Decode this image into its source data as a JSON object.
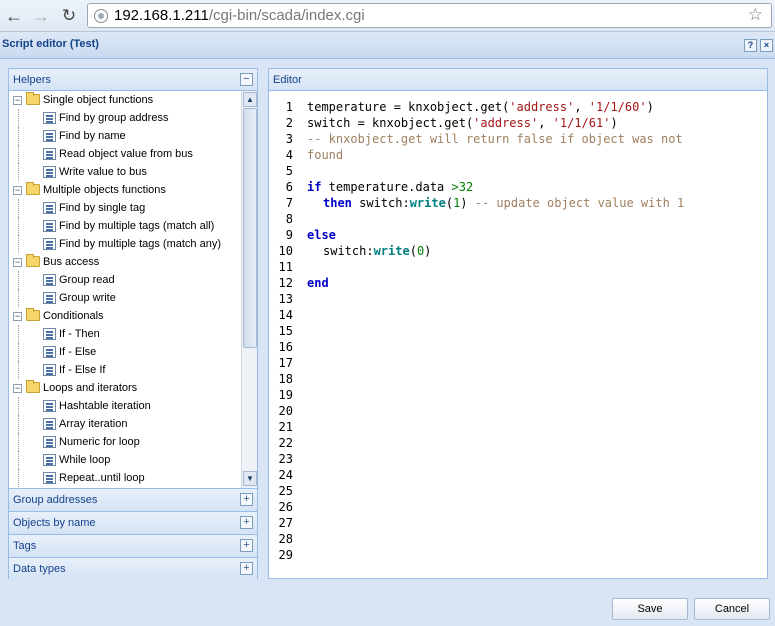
{
  "browser": {
    "url_host": "192.168.1.211",
    "url_path": "/cgi-bin/scada/index.cgi"
  },
  "window": {
    "title": "Script editor (Test)",
    "help_label": "?",
    "close_label": "×"
  },
  "helpers": {
    "title": "Helpers",
    "collapse_label": "−",
    "tree": [
      {
        "type": "folder",
        "label": "Single object functions"
      },
      {
        "type": "leaf",
        "label": "Find by group address"
      },
      {
        "type": "leaf",
        "label": "Find by name"
      },
      {
        "type": "leaf",
        "label": "Read object value from bus"
      },
      {
        "type": "leaf",
        "label": "Write value to bus"
      },
      {
        "type": "folder",
        "label": "Multiple objects functions"
      },
      {
        "type": "leaf",
        "label": "Find by single tag"
      },
      {
        "type": "leaf",
        "label": "Find by multiple tags (match all)"
      },
      {
        "type": "leaf",
        "label": "Find by multiple tags (match any)"
      },
      {
        "type": "folder",
        "label": "Bus access"
      },
      {
        "type": "leaf",
        "label": "Group read"
      },
      {
        "type": "leaf",
        "label": "Group write"
      },
      {
        "type": "folder",
        "label": "Conditionals"
      },
      {
        "type": "leaf",
        "label": "If - Then"
      },
      {
        "type": "leaf",
        "label": "If - Else"
      },
      {
        "type": "leaf",
        "label": "If - Else If"
      },
      {
        "type": "folder",
        "label": "Loops and iterators"
      },
      {
        "type": "leaf",
        "label": "Hashtable iteration"
      },
      {
        "type": "leaf",
        "label": "Array iteration"
      },
      {
        "type": "leaf",
        "label": "Numeric for loop"
      },
      {
        "type": "leaf",
        "label": "While loop"
      },
      {
        "type": "leaf",
        "label": "Repeat..until loop"
      }
    ]
  },
  "accordion": [
    {
      "label": "Group addresses",
      "expand_label": "+"
    },
    {
      "label": "Objects by name",
      "expand_label": "+"
    },
    {
      "label": "Tags",
      "expand_label": "+"
    },
    {
      "label": "Data types",
      "expand_label": "+"
    }
  ],
  "editor": {
    "title": "Editor",
    "line_numbers": [
      "1",
      "2",
      "3",
      "4",
      "5",
      "6",
      "7",
      "8",
      "9",
      "10",
      "11",
      "12",
      "13",
      "14",
      "15",
      "16",
      "17",
      "18",
      "19",
      "20",
      "21",
      "22",
      "23",
      "24",
      "25",
      "26",
      "27",
      "28",
      "29"
    ],
    "code": {
      "l1_a": "temperature = knxobject.get(",
      "l1_b": "'address'",
      "l1_c": ", ",
      "l1_d": "'1/1/60'",
      "l1_e": ")",
      "l2_a": "switch = knxobject.get(",
      "l2_b": "'address'",
      "l2_c": ", ",
      "l2_d": "'1/1/61'",
      "l2_e": ")",
      "l3": "-- knxobject.get will return false if object was not",
      "l3_wrap": "found",
      "l5_kw": "if",
      "l5_a": " temperature.data ",
      "l5_num": ">32",
      "l6_kw": "then",
      "l6_a": " switch:",
      "l6_fn": "write",
      "l6_b": "(",
      "l6_num": "1",
      "l6_c": ") ",
      "l6_cmt": "-- update object value with 1",
      "l8_kw": "else",
      "l9_a": "switch:",
      "l9_fn": "write",
      "l9_b": "(",
      "l9_num": "0",
      "l9_c": ")",
      "l11_kw": "end"
    }
  },
  "footer": {
    "save_label": "Save",
    "cancel_label": "Cancel"
  }
}
